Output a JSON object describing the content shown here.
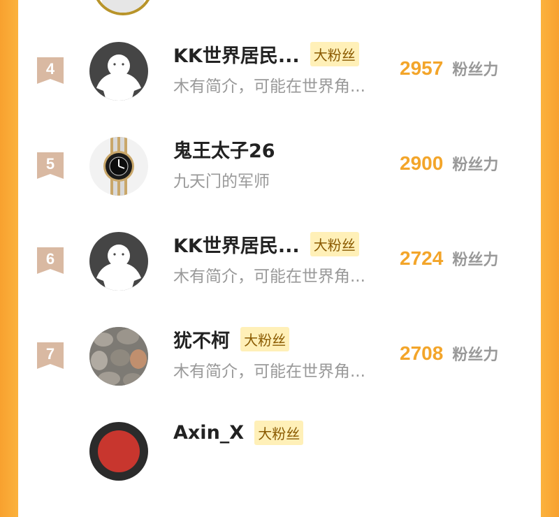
{
  "entries": [
    {
      "rank": "4",
      "name": "KK世界居民...",
      "tag": "大粉丝",
      "bio": "木有简介，可能在世界角...",
      "score": "2957",
      "score_label": "粉丝力",
      "avatar": "default-avatar"
    },
    {
      "rank": "5",
      "name": "鬼王太子26",
      "tag": "",
      "bio": "九天门的军师",
      "score": "2900",
      "score_label": "粉丝力",
      "avatar": "watch-avatar"
    },
    {
      "rank": "6",
      "name": "KK世界居民...",
      "tag": "大粉丝",
      "bio": "木有简介，可能在世界角...",
      "score": "2724",
      "score_label": "粉丝力",
      "avatar": "default-avatar"
    },
    {
      "rank": "7",
      "name": "犹不柯",
      "tag": "大粉丝",
      "bio": "木有简介，可能在世界角...",
      "score": "2708",
      "score_label": "粉丝力",
      "avatar": "stone-avatar"
    },
    {
      "rank": "",
      "name": "Axin_X",
      "tag": "大粉丝",
      "bio": "",
      "score": "",
      "score_label": "",
      "avatar": "red-avatar"
    }
  ],
  "colors": {
    "accent": "#f3a52a",
    "frame": "#f8a12f",
    "badge": "#d9b9a2",
    "tag_bg": "#fff0b8"
  }
}
